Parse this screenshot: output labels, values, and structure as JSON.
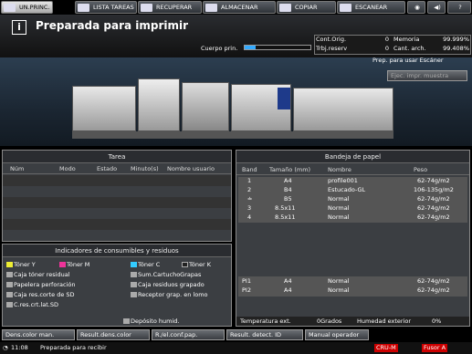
{
  "tabs": [
    {
      "label": "UN.PRINC."
    },
    {
      "label": "LISTA TAREAS"
    },
    {
      "label": "RECUPERAR"
    },
    {
      "label": "ALMACENAR"
    },
    {
      "label": "COPIAR"
    },
    {
      "label": "ESCANEAR"
    }
  ],
  "status": {
    "title": "Preparada para imprimir",
    "body_label": "Cuerpo prin.",
    "scan_ready": "Prep. para usar Escáner",
    "scan_btn": "Ejec. impr. muestra"
  },
  "counters": [
    {
      "label": "Cont.Orig.",
      "value": "0"
    },
    {
      "label": "Trbj.reserv",
      "value": "0"
    }
  ],
  "memory": [
    {
      "label": "Memoria",
      "value": "99.999%"
    },
    {
      "label": "Cant. arch.",
      "value": "99.408%"
    }
  ],
  "tarea": {
    "title": "Tarea",
    "cols": [
      "Núm",
      "Modo",
      "Estado",
      "Minuto(s)",
      "Nombre usuario"
    ]
  },
  "consumables": {
    "title": "Indicadores de consumibles y residuos",
    "items": [
      "Tóner Y",
      "Tóner M",
      "Tóner C",
      "Tóner K",
      "Caja tóner residual",
      "Sum.CartuchoGrapas",
      "Papelera perforación",
      "Caja residuos grapado",
      "Caja res.corte de SD",
      "Receptor grap. en lomo",
      "C.res.crt.lat.SD",
      "Depósito humid."
    ]
  },
  "bandeja": {
    "title": "Bandeja de papel",
    "cols": [
      "Band",
      "Tamaño (mm)",
      "Nombre",
      "Peso"
    ],
    "rows": [
      {
        "band": "1",
        "size": "A4",
        "name": "profile001",
        "weight": "62-74g/m2"
      },
      {
        "band": "2",
        "size": "B4",
        "name": "Estucado-GL",
        "weight": "106-135g/m2"
      },
      {
        "band": "≐",
        "size": "B5",
        "name": "Normal",
        "weight": "62-74g/m2"
      },
      {
        "band": "3",
        "size": "8.5x11",
        "name": "Normal",
        "weight": "62-74g/m2"
      },
      {
        "band": "4",
        "size": "8.5x11",
        "name": "Normal",
        "weight": "62-74g/m2"
      }
    ],
    "pi": [
      {
        "band": "PI1",
        "size": "A4",
        "name": "Normal",
        "weight": "62-74g/m2"
      },
      {
        "band": "PI2",
        "size": "A4",
        "name": "Normal",
        "weight": "62-74g/m2"
      }
    ],
    "temp_label": "Temperatura ext.",
    "temp_val": "0Grados",
    "hum_label": "Humedad exterior",
    "hum_val": "0%"
  },
  "bottom_buttons": [
    "Dens.color man.",
    "Result.dens.color",
    "R./el.conf.pap.",
    "Result. detect. ID",
    "Manual operador"
  ],
  "footer": {
    "time": "11:08",
    "msg": "Preparada para recibir",
    "cru": "CRU-M",
    "fusor": "Fusor A"
  }
}
